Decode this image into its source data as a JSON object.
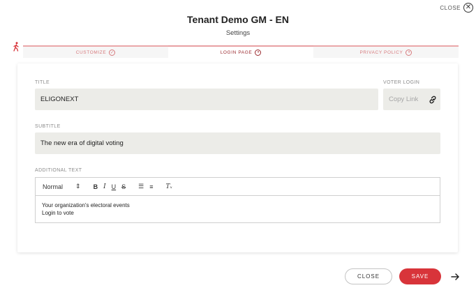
{
  "header": {
    "title": "Tenant Demo GM - EN",
    "subtitle": "Settings"
  },
  "top_close": {
    "label": "CLOSE"
  },
  "tabs": [
    {
      "label": "CUSTOMIZE",
      "active": false,
      "icon": "check-circle-icon"
    },
    {
      "label": "LOGIN PAGE",
      "active": true,
      "icon": "half-circle-icon"
    },
    {
      "label": "PRIVACY POLICY",
      "active": false,
      "icon": "half-circle-icon"
    }
  ],
  "form": {
    "title_label": "TITLE",
    "title_value": "ELIGONEXT",
    "voter_login_label": "VOTER LOGIN",
    "copy_link_placeholder": "Copy Link",
    "subtitle_label": "SUBTITLE",
    "subtitle_value": "The new era of digital voting",
    "additional_text_label": "ADDITIONAL TEXT",
    "editor": {
      "format_selected": "Normal",
      "lines": [
        "Your organization's electoral events",
        "Login to vote"
      ]
    }
  },
  "footer": {
    "close_label": "CLOSE",
    "save_label": "SAVE"
  },
  "colors": {
    "accent": "#d8343a",
    "tab_border": "#eaa7a9",
    "field_bg": "#ecece8"
  }
}
